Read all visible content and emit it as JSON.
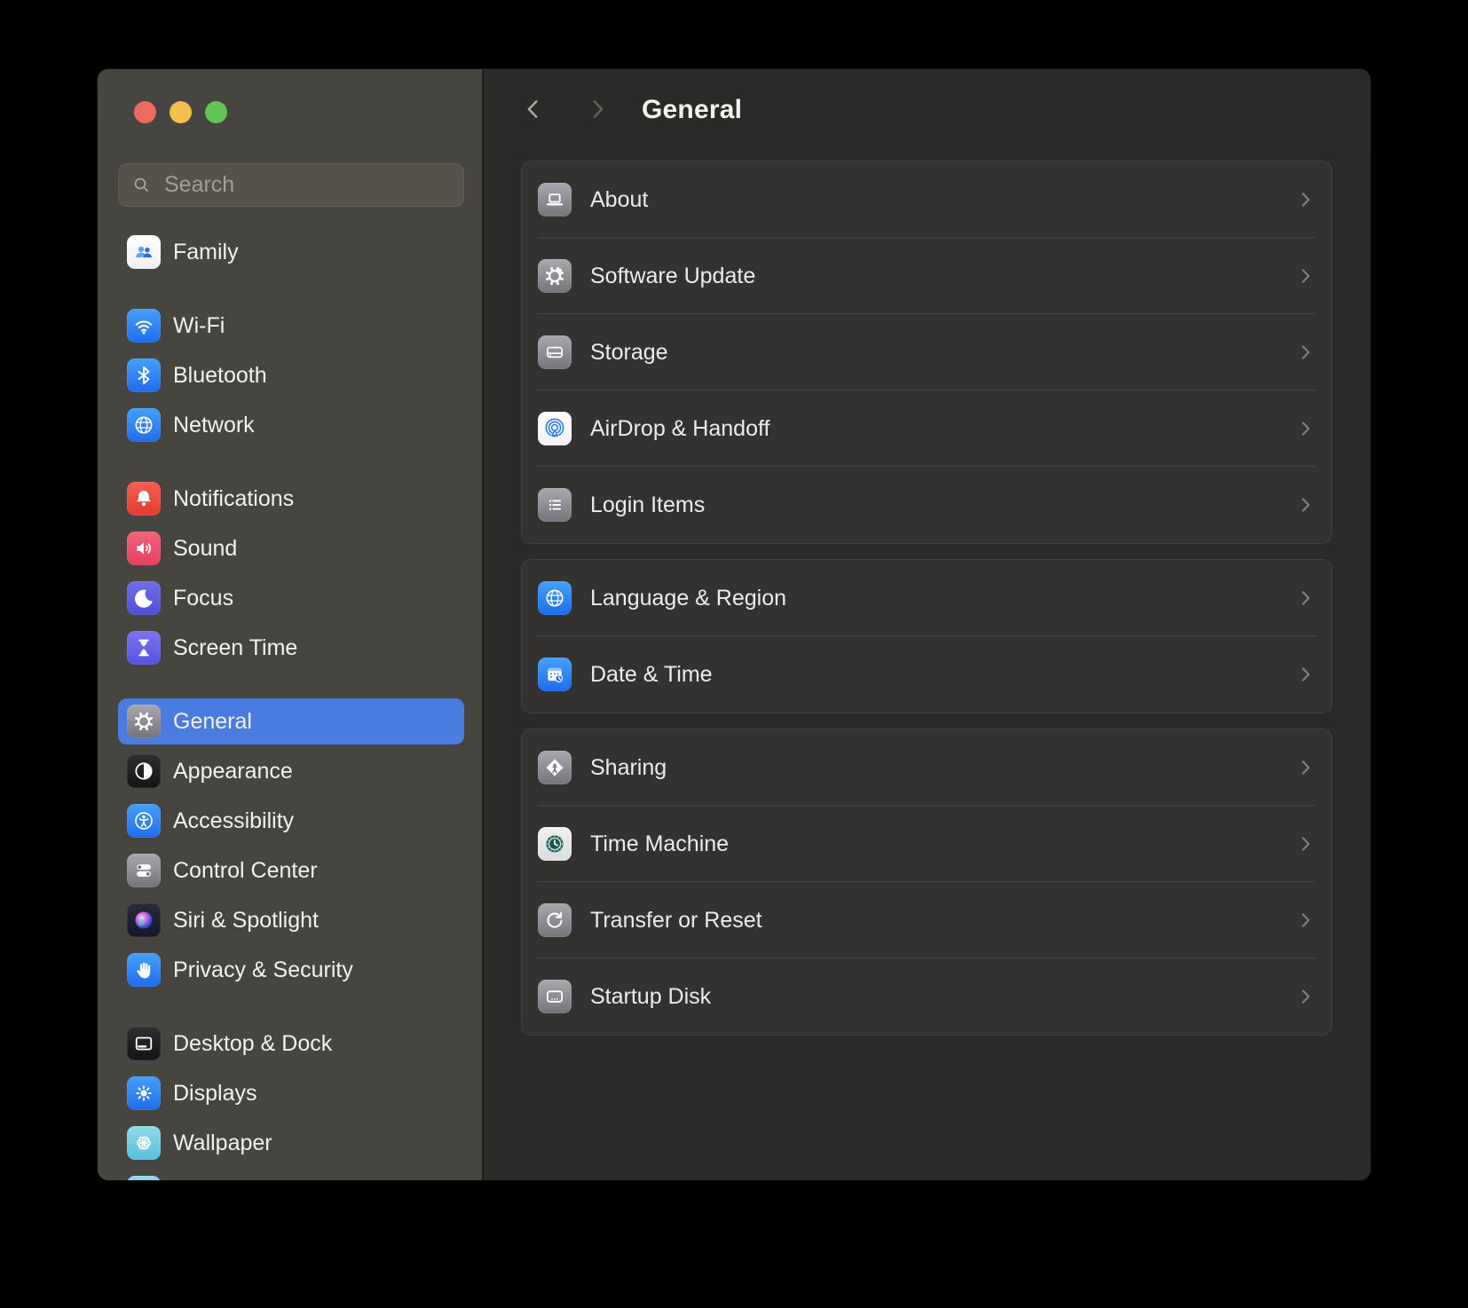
{
  "header": {
    "title": "General"
  },
  "sidebar": {
    "search": {
      "placeholder": "Search"
    },
    "groups": [
      {
        "items": [
          {
            "id": "family",
            "label": "Family",
            "icon": "family-icon",
            "style": "white"
          }
        ]
      },
      {
        "items": [
          {
            "id": "wifi",
            "label": "Wi-Fi",
            "icon": "wifi-icon",
            "style": "blue"
          },
          {
            "id": "bluetooth",
            "label": "Bluetooth",
            "icon": "bluetooth-icon",
            "style": "blue"
          },
          {
            "id": "network",
            "label": "Network",
            "icon": "network-icon",
            "style": "blue"
          }
        ]
      },
      {
        "items": [
          {
            "id": "notifications",
            "label": "Notifications",
            "icon": "notifications-icon",
            "style": "red"
          },
          {
            "id": "sound",
            "label": "Sound",
            "icon": "sound-icon",
            "style": "pink"
          },
          {
            "id": "focus",
            "label": "Focus",
            "icon": "focus-icon",
            "style": "indigo"
          },
          {
            "id": "screen-time",
            "label": "Screen Time",
            "icon": "screen-time-icon",
            "style": "purple"
          }
        ]
      },
      {
        "items": [
          {
            "id": "general",
            "label": "General",
            "icon": "general-icon",
            "style": "gray",
            "selected": true
          },
          {
            "id": "appearance",
            "label": "Appearance",
            "icon": "appearance-icon",
            "style": "black"
          },
          {
            "id": "accessibility",
            "label": "Accessibility",
            "icon": "accessibility-icon",
            "style": "blue"
          },
          {
            "id": "control-center",
            "label": "Control Center",
            "icon": "control-center-icon",
            "style": "gray"
          },
          {
            "id": "siri-spotlight",
            "label": "Siri & Spotlight",
            "icon": "siri-icon",
            "style": "siri"
          },
          {
            "id": "privacy-security",
            "label": "Privacy & Security",
            "icon": "privacy-icon",
            "style": "blue"
          }
        ]
      },
      {
        "items": [
          {
            "id": "desktop-dock",
            "label": "Desktop & Dock",
            "icon": "desktop-dock-icon",
            "style": "black"
          },
          {
            "id": "displays",
            "label": "Displays",
            "icon": "displays-icon",
            "style": "blue"
          },
          {
            "id": "wallpaper",
            "label": "Wallpaper",
            "icon": "wallpaper-icon",
            "style": "teal"
          },
          {
            "id": "partial",
            "label": "",
            "icon": "partial-icon",
            "style": "teal"
          }
        ]
      }
    ]
  },
  "content": {
    "sections": [
      {
        "items": [
          {
            "id": "about",
            "label": "About",
            "icon": "about-icon",
            "style": "gray"
          },
          {
            "id": "software-update",
            "label": "Software Update",
            "icon": "software-update-icon",
            "style": "gray"
          },
          {
            "id": "storage",
            "label": "Storage",
            "icon": "storage-icon",
            "style": "gray"
          },
          {
            "id": "airdrop-handoff",
            "label": "AirDrop & Handoff",
            "icon": "airdrop-icon",
            "style": "white"
          },
          {
            "id": "login-items",
            "label": "Login Items",
            "icon": "login-items-icon",
            "style": "gray"
          }
        ]
      },
      {
        "items": [
          {
            "id": "language-region",
            "label": "Language & Region",
            "icon": "language-region-icon",
            "style": "blue"
          },
          {
            "id": "date-time",
            "label": "Date & Time",
            "icon": "date-time-icon",
            "style": "blue"
          }
        ]
      },
      {
        "items": [
          {
            "id": "sharing",
            "label": "Sharing",
            "icon": "sharing-icon",
            "style": "gray"
          },
          {
            "id": "time-machine",
            "label": "Time Machine",
            "icon": "time-machine-icon",
            "style": "tm"
          },
          {
            "id": "transfer-reset",
            "label": "Transfer or Reset",
            "icon": "transfer-reset-icon",
            "style": "gray"
          },
          {
            "id": "startup-disk",
            "label": "Startup Disk",
            "icon": "startup-disk-icon",
            "style": "gray"
          }
        ]
      }
    ]
  },
  "colors": {
    "selection_blue": "#4a7cdf",
    "traffic_close": "#ec6b5e",
    "traffic_minimize": "#f5bf4f",
    "traffic_zoom": "#61c454",
    "sidebar_bg": "#474540",
    "content_bg": "#2b2a28",
    "card_bg": "#333231",
    "icon_bg": {
      "blue": [
        "#46a0fb",
        "#1f6cee"
      ],
      "gray": [
        "#a9a8ae",
        "#757479"
      ],
      "red": [
        "#f2604f",
        "#e53c31"
      ],
      "pink": [
        "#f2647e",
        "#e6405f"
      ],
      "indigo": [
        "#706ee9",
        "#504ed6"
      ],
      "purple": [
        "#7b74f0",
        "#5a52e4"
      ],
      "black": [
        "#2f2f31",
        "#141416"
      ],
      "white": [
        "#ffffff",
        "#f1f1f4"
      ],
      "teal": [
        "#8edaec",
        "#58c0da"
      ],
      "siri": [
        "#2a2a3e",
        "#17172a"
      ],
      "tm": [
        "#f1f2f2",
        "#dadddd"
      ]
    }
  }
}
